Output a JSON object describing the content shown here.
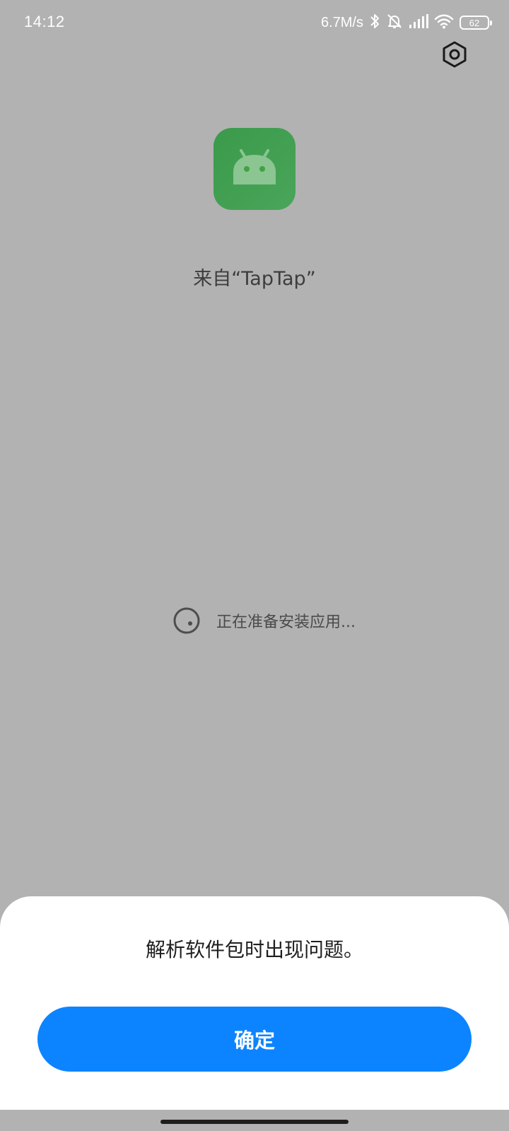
{
  "status_bar": {
    "time": "14:12",
    "net_speed": "6.7M/s",
    "battery": "62",
    "icons": [
      "bluetooth-icon",
      "mute-bell-icon",
      "signal-icon",
      "wifi-icon",
      "battery-icon"
    ]
  },
  "header": {
    "settings_icon": "gear-icon"
  },
  "app": {
    "icon": "android-icon",
    "icon_color": "#43a047",
    "source": "来自“TapTap”"
  },
  "loading": {
    "icon": "spinner-icon",
    "text": "正在准备安装应用..."
  },
  "dialog": {
    "message": "解析软件包时出现问题。",
    "confirm_label": "确定",
    "confirm_color": "#0d84ff"
  }
}
